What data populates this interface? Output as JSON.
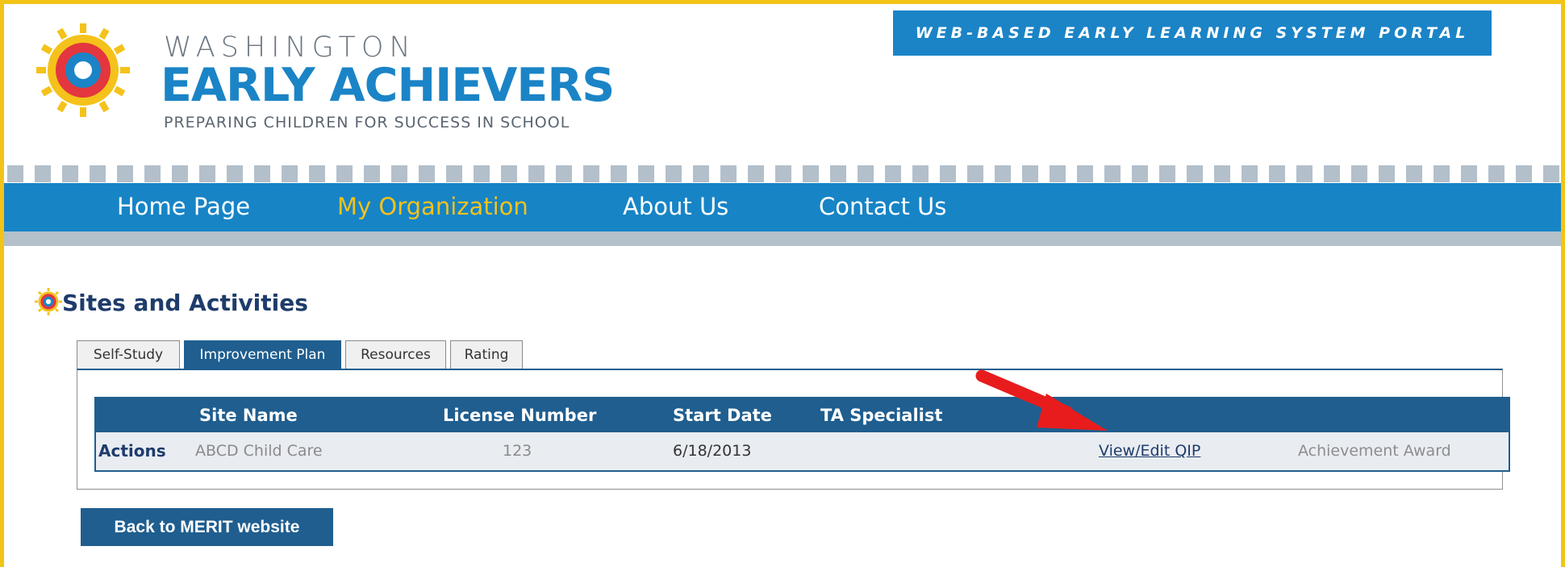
{
  "header": {
    "brand_line1": "WASHINGTON",
    "brand_line2": "EARLY ACHIEVERS",
    "brand_tagline": "PREPARING CHILDREN FOR SUCCESS IN SCHOOL",
    "portal_banner": "WEB-BASED EARLY LEARNING SYSTEM PORTAL"
  },
  "nav": {
    "items": [
      {
        "label": "Home Page",
        "active": false
      },
      {
        "label": "My Organization",
        "active": true
      },
      {
        "label": "About Us",
        "active": false
      },
      {
        "label": "Contact Us",
        "active": false
      }
    ]
  },
  "section": {
    "title": "Sites and Activities"
  },
  "tabs": [
    {
      "label": "Self-Study",
      "active": false
    },
    {
      "label": "Improvement Plan",
      "active": true
    },
    {
      "label": "Resources",
      "active": false
    },
    {
      "label": "Rating",
      "active": false
    }
  ],
  "grid": {
    "headers": {
      "site_name": "Site Name",
      "license_number": "License Number",
      "start_date": "Start Date",
      "ta_specialist": "TA Specialist"
    },
    "row": {
      "actions_label": "Actions",
      "site_name": "ABCD Child Care",
      "license_number": "123",
      "start_date": "6/18/2013",
      "ta_specialist": "",
      "view_edit_link": "View/Edit QIP",
      "award_link": "Achievement Award"
    }
  },
  "buttons": {
    "back_to_merit": "Back to MERIT website"
  },
  "colors": {
    "frame_border": "#f2c417",
    "brand_blue": "#1b84c6",
    "nav_active": "#f4c21a",
    "table_header": "#1f5e8f",
    "arrow_red": "#e81c1c"
  },
  "icons": {
    "logo": "sun-target-icon",
    "section": "sun-target-icon",
    "annotation": "red-arrow-icon"
  }
}
